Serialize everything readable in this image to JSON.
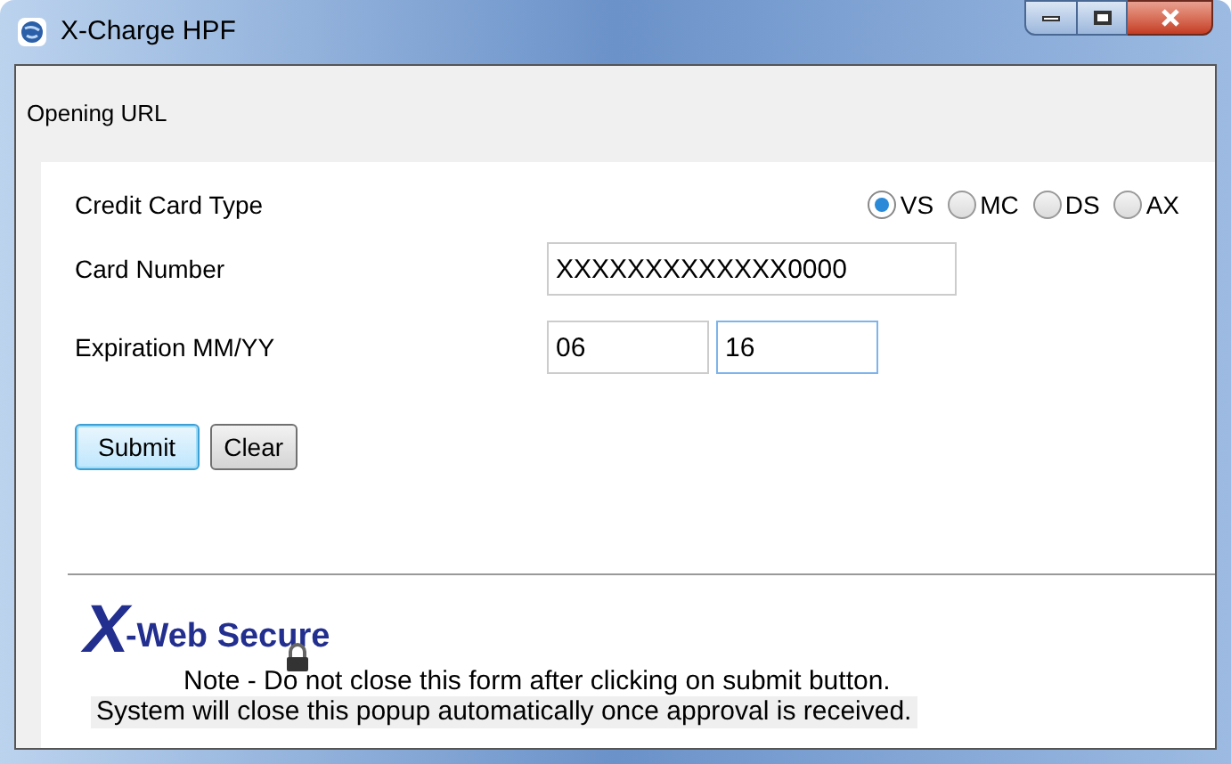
{
  "window": {
    "title": "X-Charge HPF"
  },
  "status": "Opening URL",
  "form": {
    "card_type": {
      "label": "Credit Card Type",
      "options": [
        {
          "label": "VS",
          "selected": true
        },
        {
          "label": "MC",
          "selected": false
        },
        {
          "label": "DS",
          "selected": false
        },
        {
          "label": "AX",
          "selected": false
        }
      ]
    },
    "card_number": {
      "label": "Card Number",
      "value": "XXXXXXXXXXXXX0000"
    },
    "expiration": {
      "label": "Expiration MM/YY",
      "month": "06",
      "year": "16"
    },
    "buttons": [
      {
        "label": "Submit",
        "focused": true
      },
      {
        "label": "Clear",
        "focused": false
      }
    ]
  },
  "logo": {
    "mark": "X",
    "text": "-Web Secure"
  },
  "note": "Note - Do not close this form after clicking on submit button.",
  "message": "System will close this popup automatically once approval is received."
}
